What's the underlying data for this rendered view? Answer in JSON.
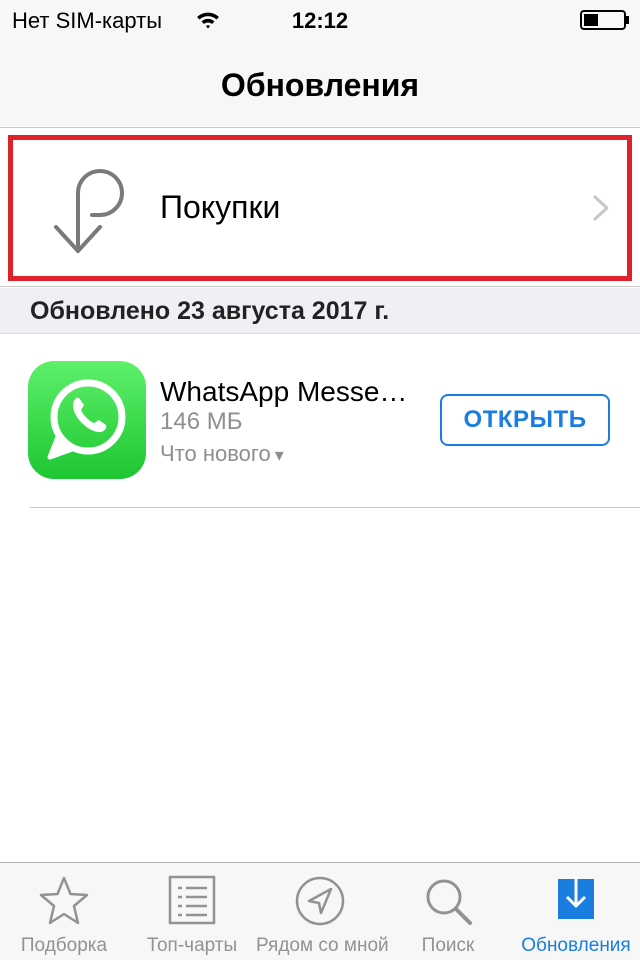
{
  "status_bar": {
    "carrier": "Нет SIM-карты",
    "time": "12:12"
  },
  "nav": {
    "title": "Обновления"
  },
  "purchases": {
    "label": "Покупки",
    "icon": "purchases-loop-arrow-icon"
  },
  "section": {
    "header": "Обновлено 23 августа 2017 г."
  },
  "app": {
    "name": "WhatsApp Messe…",
    "size": "146 МБ",
    "whats_new": "Что нового",
    "whats_new_arrow": "▾",
    "open_label": "ОТКРЫТЬ",
    "icon": "whatsapp-icon"
  },
  "tab_bar": {
    "tabs": [
      {
        "label": "Подборка",
        "icon": "star-icon"
      },
      {
        "label": "Топ-чарты",
        "icon": "list-icon"
      },
      {
        "label": "Рядом со мной",
        "icon": "location-arrow-icon"
      },
      {
        "label": "Поиск",
        "icon": "search-icon"
      },
      {
        "label": "Обновления",
        "icon": "updates-icon"
      }
    ],
    "active_index": 4
  },
  "colors": {
    "accent": "#1a7de0",
    "highlight_frame": "#e0202a",
    "whatsapp_green": "#2bd43e",
    "inactive_tab": "#929292"
  }
}
